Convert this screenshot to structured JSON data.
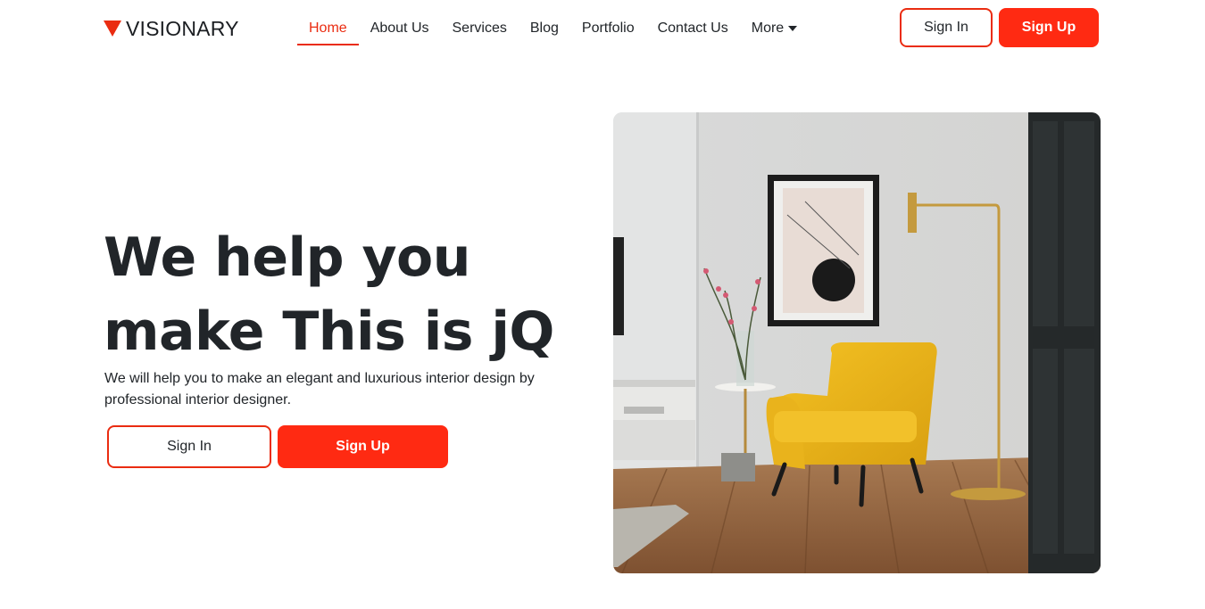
{
  "brand": {
    "name": "VISIONARY",
    "color": "#ea2c11"
  },
  "nav": {
    "items": [
      {
        "label": "Home",
        "active": true
      },
      {
        "label": "About Us"
      },
      {
        "label": "Services"
      },
      {
        "label": "Blog"
      },
      {
        "label": "Portfolio"
      },
      {
        "label": "Contact Us"
      },
      {
        "label": "More",
        "dropdown": true
      }
    ]
  },
  "header_actions": {
    "sign_in": "Sign In",
    "sign_up": "Sign Up"
  },
  "hero": {
    "title_line1": "We help you",
    "title_line2": "make This is jQ",
    "subtitle": "We will help you to make an elegant and luxurious interior design by professional interior designer.",
    "sign_in": "Sign In",
    "sign_up": "Sign Up",
    "image_icon": "interior-photo"
  },
  "colors": {
    "accent": "#ff2a12",
    "accent_border": "#ea2c11",
    "text": "#212529"
  }
}
